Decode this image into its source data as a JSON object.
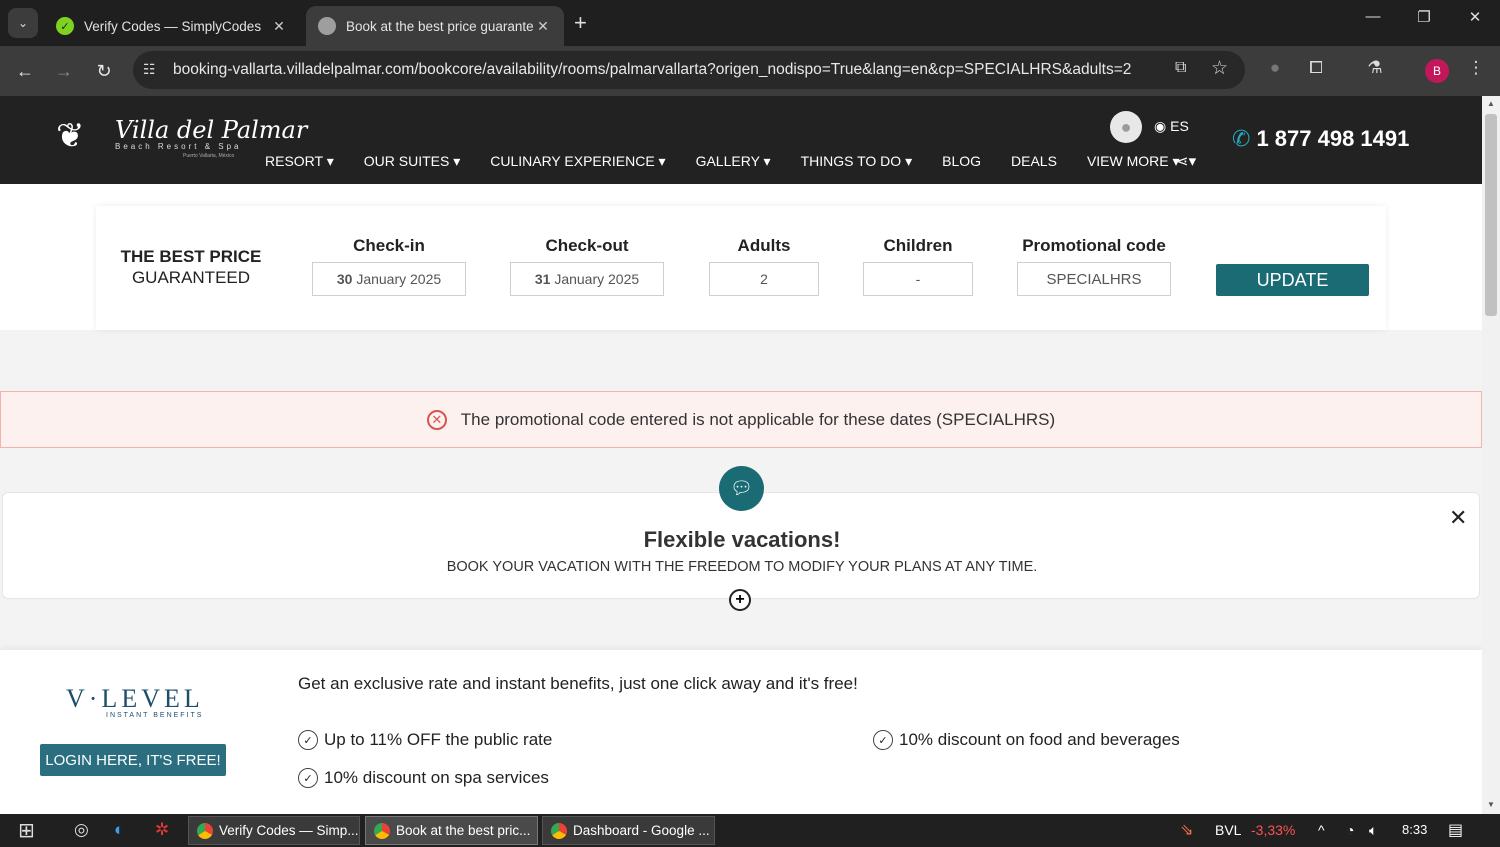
{
  "browser": {
    "tabs": [
      {
        "title": "Verify Codes — SimplyCodes",
        "active": false
      },
      {
        "title": "Book at the best price guarante",
        "active": true
      }
    ],
    "url": "booking-vallarta.villadelpalmar.com/bookcore/availability/rooms/palmarvallarta?origen_nodispo=True&lang=en&cp=SPECIALHRS&adults=2",
    "profile_initial": "B"
  },
  "site": {
    "logo_text": "Villa del Palmar",
    "logo_sub": "Beach Resort & Spa",
    "logo_sub2": "Puerto Vallarta, México",
    "nav": [
      "RESORT ▾",
      "OUR SUITES ▾",
      "CULINARY EXPERIENCE ▾",
      "GALLERY ▾",
      "THINGS TO DO ▾",
      "BLOG",
      "DEALS",
      "VIEW MORE ▾"
    ],
    "lang": "ES",
    "phone": "1 877 498 1491"
  },
  "booking": {
    "title_line1": "THE BEST PRICE",
    "title_line2": "GUARANTEED",
    "checkin_label": "Check-in",
    "checkin_day": "30",
    "checkin_rest": "January 2025",
    "checkout_label": "Check-out",
    "checkout_day": "31",
    "checkout_rest": "January 2025",
    "adults_label": "Adults",
    "adults_value": "2",
    "children_label": "Children",
    "children_value": "-",
    "promo_label": "Promotional code",
    "promo_value": "SPECIALHRS",
    "update_label": "UPDATE"
  },
  "alert": {
    "message": "The promotional code entered is not applicable for these dates (SPECIALHRS)"
  },
  "flexible": {
    "title": "Flexible vacations!",
    "subtitle": "BOOK YOUR VACATION WITH THE FREEDOM TO MODIFY YOUR PLANS AT ANY TIME."
  },
  "vlevel": {
    "logo": "V·LEVEL",
    "logo_sub": "INSTANT BENEFITS",
    "login_label": "LOGIN HERE, IT'S FREE!",
    "headline": "Get an exclusive rate and instant benefits, just one click away and it's free!",
    "benefits": [
      "Up to 11% OFF the public rate",
      "10% discount on food and beverages",
      "10% discount on spa services"
    ]
  },
  "taskbar": {
    "apps": [
      "Verify Codes — Simp...",
      "Book at the best pric...",
      "Dashboard - Google ..."
    ],
    "ticker": "BVL",
    "ticker_change": "-3,33%",
    "time": "8:33"
  },
  "colors": {
    "teal": "#1a6b73",
    "alert_red": "#d9534f",
    "header_dark": "#222222"
  }
}
